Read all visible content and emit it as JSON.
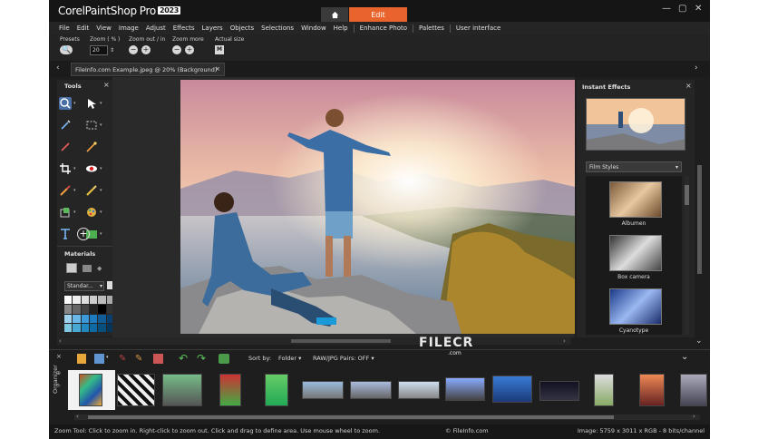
{
  "app": {
    "brand": "Corel",
    "product": "PaintShop",
    "product_suffix": "Pro",
    "year": "2023",
    "home_tab_icon": "home-icon",
    "edit_tab": "Edit",
    "accent": "#e8642c"
  },
  "menu": [
    "File",
    "Edit",
    "View",
    "Image",
    "Adjust",
    "Effects",
    "Layers",
    "Objects",
    "Selections",
    "Window",
    "Help",
    "Enhance Photo",
    "Palettes",
    "User interface"
  ],
  "tool_options": {
    "presets_label": "Presets",
    "zoom_label": "Zoom ( % )",
    "zoom_value": "20",
    "zoom_inout_label": "Zoom out / in",
    "zoom_more_label": "Zoom more",
    "actual_size_label": "Actual size",
    "actual_size_btn": "M"
  },
  "document_tab": {
    "title": "FileInfo.com Example.jpeg @  20% (Background)",
    "close": "×"
  },
  "tools_panel": {
    "title": "Tools",
    "close": "×",
    "tools": [
      "pan-zoom-icon",
      "pick-tool-icon",
      "selection-icon",
      "selection-rect-icon",
      "straighten-icon",
      "makeover-icon",
      "crop-icon",
      "red-eye-icon",
      "paint-brush-icon",
      "clone-brush-icon",
      "fill-icon",
      "color-changer-icon",
      "text-icon",
      "shape-icon",
      "add-tool-icon"
    ]
  },
  "materials_panel": {
    "title": "Materials",
    "close": "×",
    "palette_select": "Standar..."
  },
  "instant_effects": {
    "title": "Instant Effects",
    "close": "×",
    "category": "Film Styles",
    "effects": [
      "Albumen",
      "Box camera",
      "Cyanotype"
    ]
  },
  "organizer": {
    "label": "Organizer",
    "sort_label": "Sort by:",
    "sort_value": "Folder",
    "raw_pairs": "RAW/JPG Pairs: OFF"
  },
  "status": {
    "hint": "Zoom Tool: Click to zoom in. Right-click to zoom out. Click and drag to define area. Use mouse wheel to zoom.",
    "copyright": "© FileInfo.com",
    "image_info": "Image:  5759 x 3011 x RGB - 8 bits/channel"
  },
  "watermark": {
    "text": "FILECR",
    "sub": ".com"
  }
}
